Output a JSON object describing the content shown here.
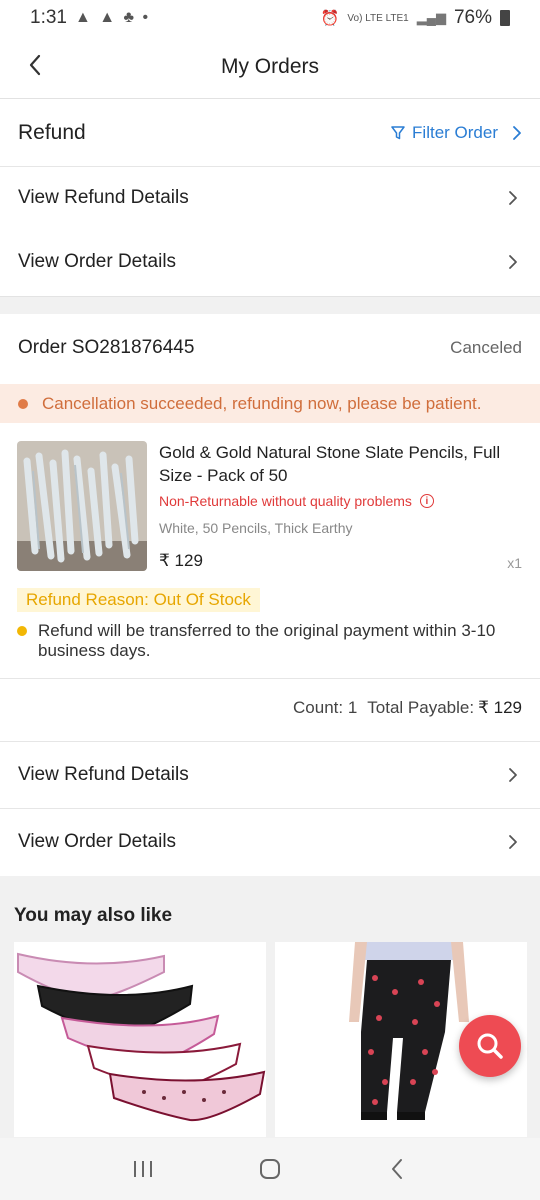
{
  "status_bar": {
    "time": "1:31",
    "notif_icons": "▲ ▲ ♣ •",
    "signal_text": "Vo) LTE LTE1",
    "battery": "76%"
  },
  "header": {
    "title": "My Orders",
    "back_icon": "chevron-left-icon"
  },
  "refund_section": {
    "title": "Refund",
    "filter_label": "Filter Order",
    "rows": [
      {
        "label": "View Refund Details"
      },
      {
        "label": "View Order Details"
      }
    ]
  },
  "order": {
    "order_number": "Order SO281876445",
    "status": "Canceled",
    "notice": "Cancellation succeeded, refunding now, please be patient.",
    "product": {
      "title": "Gold & Gold Natural Stone Slate Pencils, Full Size - Pack of 50",
      "non_returnable": "Non-Returnable without quality problems",
      "variant": "White, 50 Pencils, Thick Earthy",
      "price": "₹ 129",
      "quantity": "x1"
    },
    "refund_reason": "Refund Reason: Out Of Stock",
    "refund_note": "Refund will be transferred to the original payment within 3-10 business days.",
    "count_label": "Count: 1",
    "total_label": "Total Payable:",
    "total_amount": "₹ 129",
    "rows": [
      {
        "label": "View Refund Details"
      },
      {
        "label": "View Order Details"
      }
    ]
  },
  "recommendations": {
    "heading": "You may also like"
  },
  "colors": {
    "accent_blue": "#2a7dd4",
    "notice_bg": "#fcebe2",
    "notice_text": "#d06e3c",
    "error_red": "#e03a3a",
    "reason_yellow": "#e7a600",
    "fab_red": "#ee4b53"
  }
}
